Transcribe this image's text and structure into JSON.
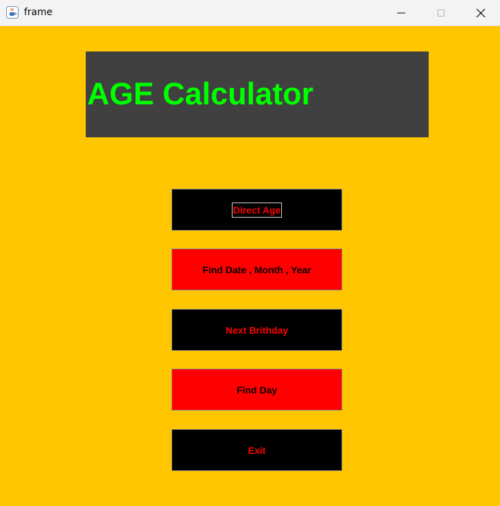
{
  "window": {
    "title": "frame",
    "app_icon": "java-cup-icon",
    "controls": [
      "minimize-icon",
      "maximize-icon",
      "close-icon"
    ]
  },
  "header": {
    "title": "AGE Calculator"
  },
  "menu": {
    "direct_age": "Direct Age",
    "find_date": "Find Date , Month , Year",
    "next_birthday": "Next Brithday",
    "find_day": "Find Day",
    "exit": "Exit"
  },
  "colors": {
    "background": "#ffc600",
    "header_panel": "#404040",
    "header_text": "#00ff00",
    "button_dark": "#000000",
    "button_red": "#ff0000"
  }
}
